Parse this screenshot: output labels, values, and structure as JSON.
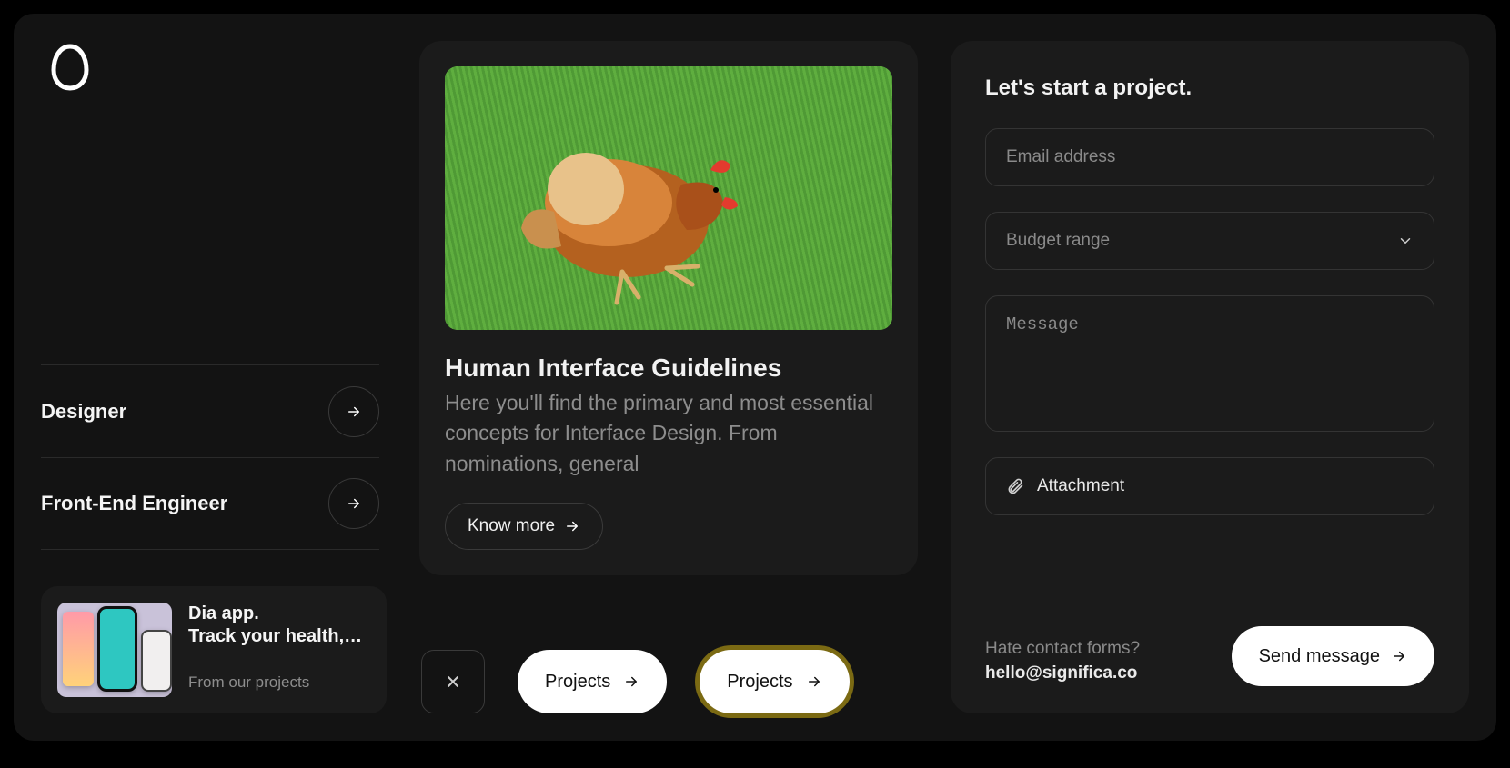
{
  "left": {
    "roles": [
      {
        "title": "Designer"
      },
      {
        "title": "Front-End Engineer"
      }
    ],
    "project_card": {
      "title": "Dia app.\nTrack your health,…",
      "category": "From our projects"
    }
  },
  "center": {
    "article": {
      "title": "Human Interface Guidelines",
      "body": "Here you'll find the primary and most essential concepts for Interface Design. From nominations, general",
      "cta": "Know more"
    },
    "pills": {
      "projects_a": "Projects",
      "projects_b": "Projects"
    }
  },
  "right": {
    "title": "Let's start a project.",
    "email_placeholder": "Email address",
    "budget_placeholder": "Budget range",
    "message_placeholder": "Message",
    "attachment_label": "Attachment",
    "hate_text": "Hate contact forms?",
    "email": "hello@significa.co",
    "send_label": "Send message"
  }
}
